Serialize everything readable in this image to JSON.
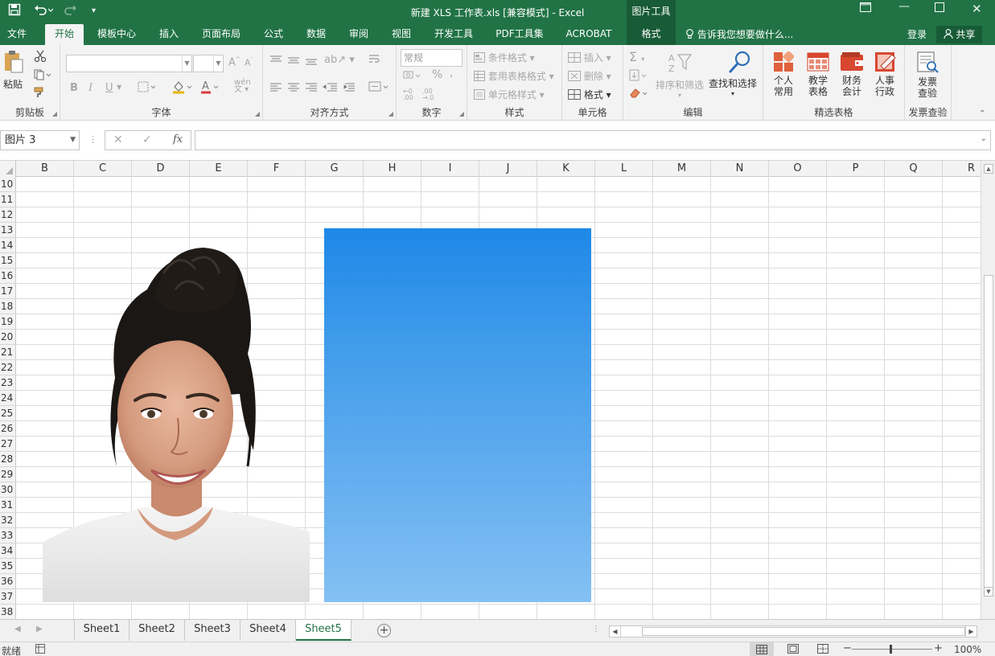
{
  "titlebar": {
    "title": "新建 XLS 工作表.xls  [兼容模式] - Excel",
    "context_group": "图片工具",
    "save_icon": "save-icon",
    "undo_icon": "undo-icon",
    "redo_icon": "redo-icon"
  },
  "tabs": {
    "file": "文件",
    "home": "开始",
    "template": "模板中心",
    "insert": "插入",
    "layout": "页面布局",
    "formula": "公式",
    "data": "数据",
    "review": "审阅",
    "view": "视图",
    "developer": "开发工具",
    "pdf": "PDF工具集",
    "acrobat": "ACROBAT",
    "format": "格式",
    "tell_me": "告诉我您想要做什么...",
    "login": "登录",
    "share": "共享"
  },
  "ribbon": {
    "clipboard": {
      "label": "剪贴板",
      "paste": "粘贴"
    },
    "font": {
      "label": "字体",
      "bold": "B",
      "italic": "I",
      "underline": "U"
    },
    "alignment": {
      "label": "对齐方式"
    },
    "number": {
      "label": "数字",
      "format": "常规"
    },
    "styles": {
      "label": "样式",
      "conditional": "条件格式",
      "table": "套用表格格式",
      "cell": "单元格样式"
    },
    "cells": {
      "label": "单元格",
      "insert": "插入",
      "delete": "删除",
      "format": "格式"
    },
    "editing": {
      "label": "编辑",
      "sort": "排序和筛选",
      "find": "查找和选择"
    },
    "templates": {
      "label": "精选表格",
      "personal_1": "个人",
      "personal_2": "常用",
      "teach_1": "教学",
      "teach_2": "表格",
      "finance_1": "财务",
      "finance_2": "会计",
      "hr_1": "人事",
      "hr_2": "行政"
    },
    "invoice": {
      "label": "发票查验",
      "btn_1": "发票",
      "btn_2": "查验"
    }
  },
  "formula_bar": {
    "name_box": "图片 3",
    "fx": "fx"
  },
  "columns": [
    "B",
    "C",
    "D",
    "E",
    "F",
    "G",
    "H",
    "I",
    "J",
    "K",
    "L",
    "M",
    "N",
    "O",
    "P",
    "Q",
    "R"
  ],
  "rows": [
    "10",
    "11",
    "12",
    "13",
    "14",
    "15",
    "16",
    "17",
    "18",
    "19",
    "20",
    "21",
    "22",
    "23",
    "24",
    "25",
    "26",
    "27",
    "28",
    "29",
    "30",
    "31",
    "32",
    "33",
    "34",
    "35",
    "36",
    "37",
    "38"
  ],
  "sheets": [
    "Sheet1",
    "Sheet2",
    "Sheet3",
    "Sheet4",
    "Sheet5"
  ],
  "active_sheet": "Sheet5",
  "status": {
    "ready": "就绪",
    "zoom": "100%"
  },
  "colors": {
    "excel_green": "#217346",
    "dark_green": "#185c37",
    "blue_top": "#1e88e8",
    "blue_bottom": "#84c0f3"
  }
}
